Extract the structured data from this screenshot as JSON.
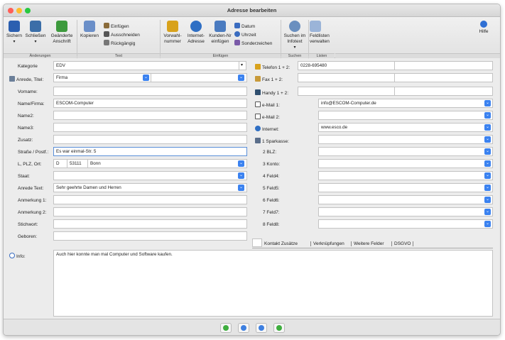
{
  "window": {
    "title": "Adresse bearbeiten"
  },
  "toolbar": {
    "sichern": "Sichern",
    "schliessen": "Schließen",
    "geaenderte_anschrift_1": "Geänderte",
    "geaenderte_anschrift_2": "Anschrift",
    "kopieren": "Kopieren",
    "einfuegen": "Einfügen",
    "ausschneiden": "Ausschneiden",
    "rueckgaengig": "Rückgängig",
    "vorwahlnummer_1": "Vorwahl-",
    "vorwahlnummer_2": "nummer",
    "internet_adresse_1": "Internet-",
    "internet_adresse_2": "Adresse",
    "kunden_nr_1": "Kunden-Nr",
    "kunden_nr_2": "einfügen",
    "datum": "Datum",
    "uhrzeit": "Uhrzeit",
    "sonderzeichen": "Sonderzeichen",
    "suchen_infotext_1": "Suchen im",
    "suchen_infotext_2": "Infotext",
    "feldlisten_1": "Feldlisten",
    "feldlisten_2": "verwalten",
    "hilfe": "Hilfe",
    "groups": {
      "aenderungen": "Änderungen",
      "text": "Text",
      "einfuegen": "Einfügen",
      "suchen": "Suchen",
      "listen": "Listen"
    }
  },
  "form_left": {
    "kategorie": {
      "label": "Kategorie",
      "value": "EDV"
    },
    "anrede_titel": {
      "label": "Anrede, Titel:",
      "value": "Firma",
      "value2": ""
    },
    "vorname": {
      "label": "Vorname:",
      "value": ""
    },
    "name_firma": {
      "label": "Name/Firma:",
      "value": "ESCOM-Computer"
    },
    "name2": {
      "label": "Name2:",
      "value": ""
    },
    "name3": {
      "label": "Name3:",
      "value": ""
    },
    "zusatz": {
      "label": "Zusatz:",
      "value": ""
    },
    "strasse": {
      "label": "Straße / Postf.:",
      "value": "Es war einmal-Str. 5"
    },
    "lplz_ort": {
      "label": "L, PLZ, Ort:",
      "land": "D",
      "plz": "53111",
      "ort": "Bonn"
    },
    "staat": {
      "label": "Staat:",
      "value": ""
    },
    "anrede_text": {
      "label": "Anrede Text:",
      "value": "Sehr geehrte Damen und Herren"
    },
    "anmerkung1": {
      "label": "Anmerkung 1:",
      "value": ""
    },
    "anmerkung2": {
      "label": "Anmerkung 2:",
      "value": ""
    },
    "stichwort": {
      "label": "Stichwort:",
      "value": ""
    },
    "geboren": {
      "label": "Geboren:",
      "value": ""
    }
  },
  "form_right": {
    "telefon": {
      "label": "Telefon 1 + 2:",
      "value1": "0228-695480",
      "value2": ""
    },
    "fax": {
      "label": "Fax 1 + 2:",
      "value1": "",
      "value2": ""
    },
    "handy": {
      "label": "Handy 1 + 2:",
      "value1": "",
      "value2": ""
    },
    "email1": {
      "label": "e-Mail 1:",
      "value": "info@ESCOM-Computer.de"
    },
    "email2": {
      "label": "e-Mail 2:",
      "value": ""
    },
    "internet": {
      "label": "Internet:",
      "value": "www.esco.de"
    },
    "sparkasse": {
      "label": "1 Sparkasse:",
      "value": ""
    },
    "blz": {
      "label": "2 BLZ:",
      "value": ""
    },
    "konto": {
      "label": "3 Konto:",
      "value": ""
    },
    "feld4": {
      "label": "4 Feld4:",
      "value": ""
    },
    "feld5": {
      "label": "5 Feld5:",
      "value": ""
    },
    "feld6": {
      "label": "6 Feld6:",
      "value": ""
    },
    "feld7": {
      "label": "7 Feld7:",
      "value": ""
    },
    "feld8": {
      "label": "8 Feld8:",
      "value": ""
    }
  },
  "tabs": {
    "kontakt_zusaetze": "Kontakt  Zusätze",
    "verknuepfungen": "Verknüpfungen",
    "weitere_felder": "Weitere Felder",
    "dsgvo": "DSGVO"
  },
  "info": {
    "label": "Info:",
    "text": "Auch hier konnte man mal Computer und Software kaufen."
  },
  "colors": {
    "accent": "#3b82f0",
    "navgreen": "#3fae3f",
    "navblue": "#3d7fe0"
  }
}
